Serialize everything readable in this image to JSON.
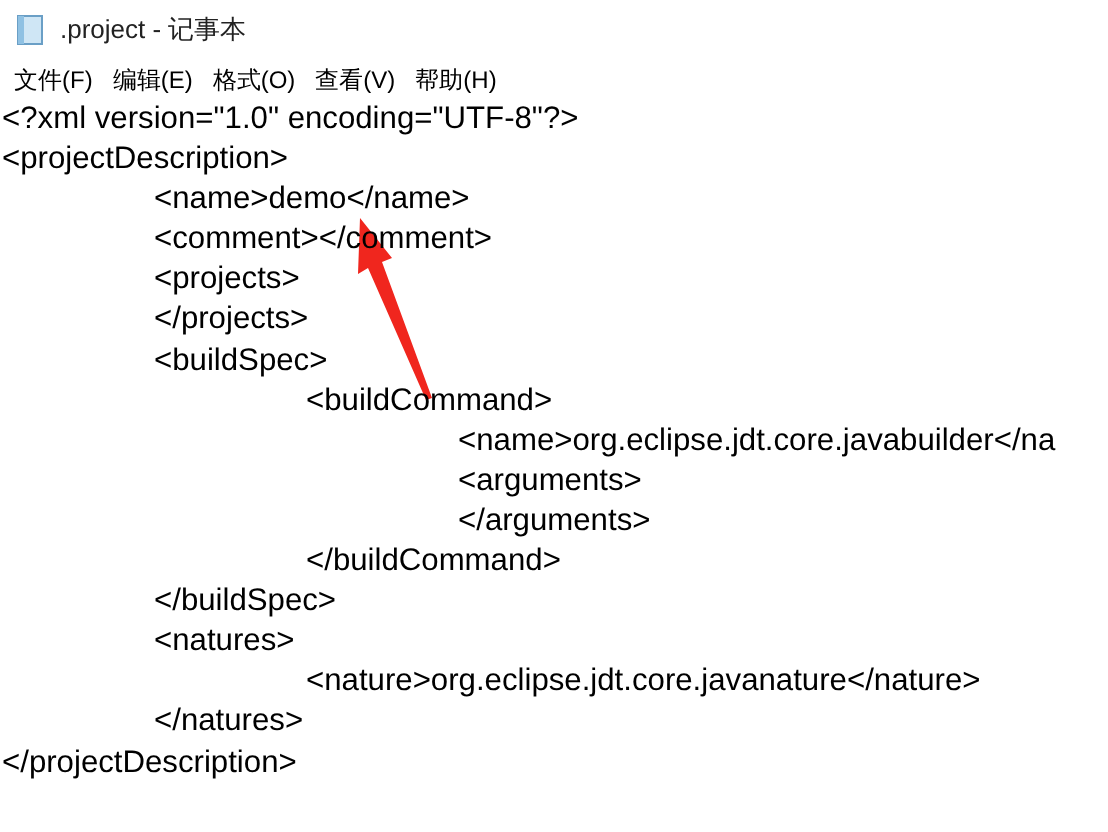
{
  "window": {
    "title": ".project - 记事本"
  },
  "menu": [
    "文件(F)",
    "编辑(E)",
    "格式(O)",
    "查看(V)",
    "帮助(H)"
  ],
  "editor": {
    "lines": [
      "<?xml version=\"1.0\" encoding=\"UTF-8\"?>",
      "<projectDescription>",
      "\t<name>demo</name>",
      "\t<comment></comment>",
      "\t<projects>",
      "\t</projects>",
      "\t<buildSpec>",
      "\t\t<buildCommand>",
      "\t\t\t<name>org.eclipse.jdt.core.javabuilder</na",
      "\t\t\t<arguments>",
      "\t\t\t</arguments>",
      "\t\t</buildCommand>",
      "\t</buildSpec>",
      "\t<natures>",
      "\t\t<nature>org.eclipse.jdt.core.javanature</nature>",
      "\t</natures>",
      "</projectDescription>"
    ]
  }
}
